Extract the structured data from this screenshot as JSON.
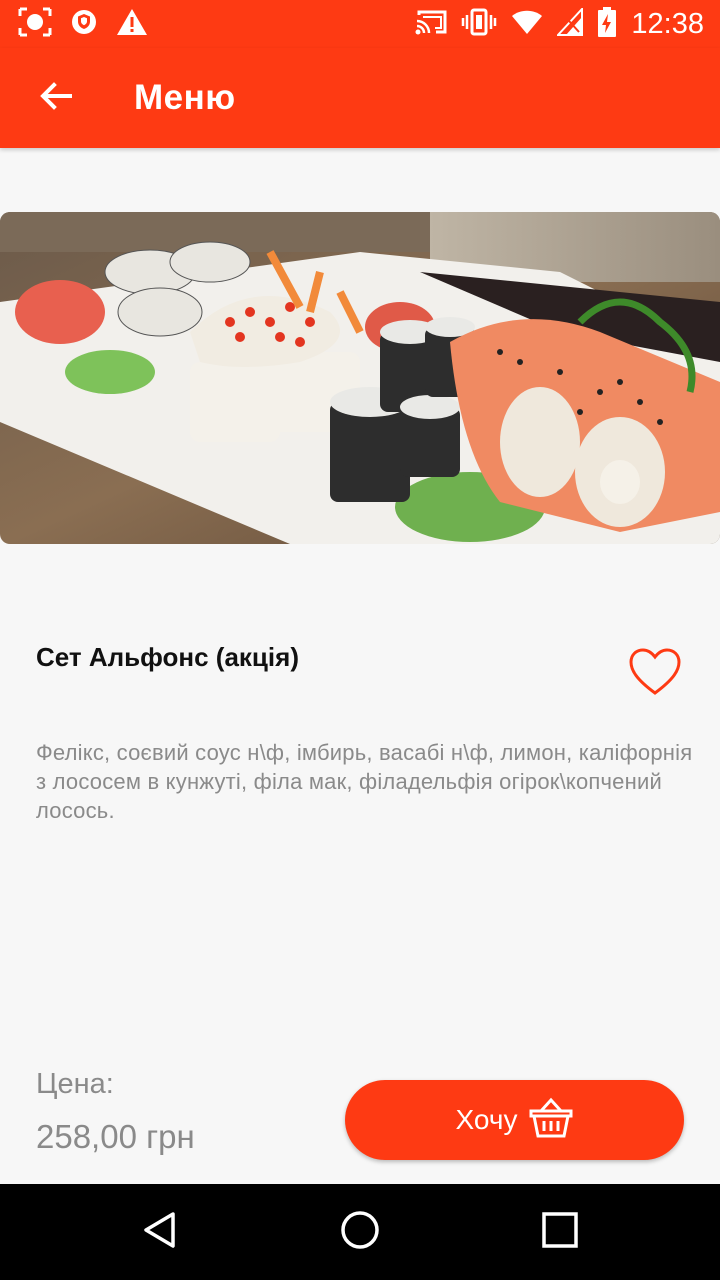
{
  "status_bar": {
    "time": "12:38",
    "left_icons": [
      "screen-record-icon",
      "shield-icon",
      "warning-icon"
    ],
    "right_icons": [
      "cast-icon",
      "vibrate-icon",
      "wifi-icon",
      "signal-icon",
      "battery-charging-icon"
    ]
  },
  "app_bar": {
    "title": "Меню",
    "back_icon": "arrow-back-icon"
  },
  "product": {
    "image": "sushi-set-photo",
    "title": "Сет Альфонс (акція)",
    "favorite_icon": "heart-outline-icon",
    "description": "Фелікс, соєвий соус н\\ф, імбирь, васабі н\\ф, лимон, каліфорнія з лососем в кунжуті, філа мак, філадельфія огірок\\копчений лосось.",
    "price_label": "Цена:",
    "price_value": "258,00 грн",
    "buy_label": "Хочу",
    "buy_icon": "basket-icon"
  },
  "nav_bar": {
    "back": "triangle-back-icon",
    "home": "circle-home-icon",
    "recents": "square-recents-icon"
  },
  "colors": {
    "accent": "#fe3a13",
    "background": "#f7f7f7",
    "text_primary": "#111111",
    "text_secondary": "#8a8a8a"
  }
}
